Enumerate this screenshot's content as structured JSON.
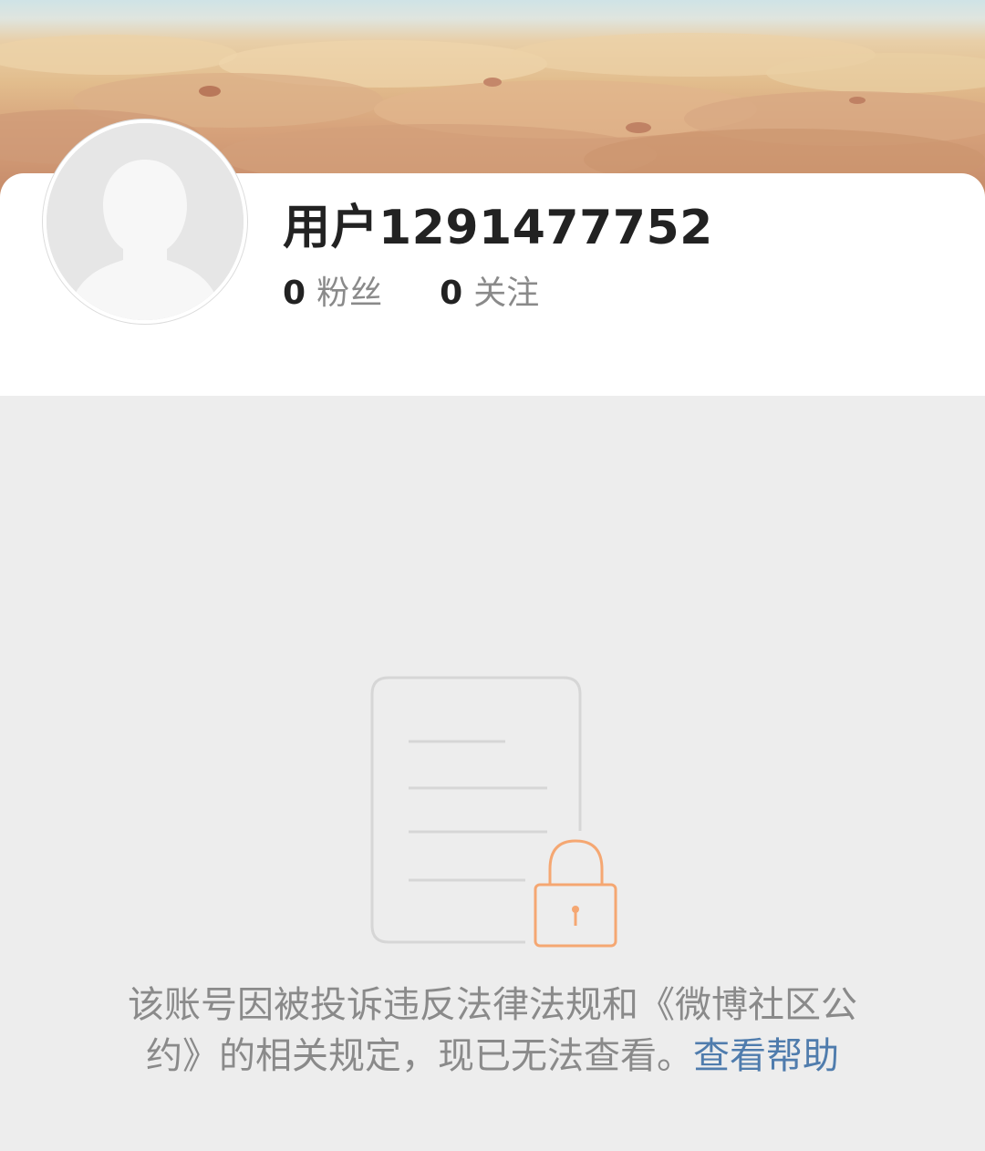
{
  "profile": {
    "username": "用户1291477752",
    "followers_count": "0",
    "followers_label": "粉丝",
    "following_count": "0",
    "following_label": "关注"
  },
  "notice": {
    "line1": "该账号因被投诉违反法律法规和《微博社区公",
    "line2_prefix": "约》的相关规定，现已无法查看。",
    "help_link": "查看帮助"
  },
  "colors": {
    "page_background": "#ededed",
    "card_background": "#ffffff",
    "text_primary": "#222222",
    "text_secondary": "#8a8a8a",
    "link": "#4f7cad",
    "lock_accent": "#f5a772",
    "document_outline": "#d6d6d6"
  },
  "icons": {
    "avatar": "default-avatar-icon",
    "illustration": "locked-document-icon",
    "lock": "lock-icon"
  }
}
